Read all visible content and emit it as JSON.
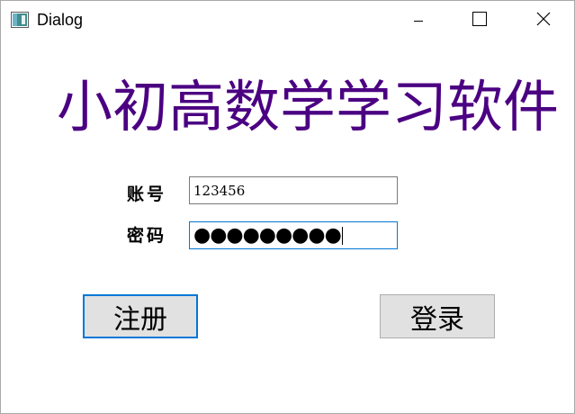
{
  "window": {
    "title": "Dialog",
    "icon": "app-window-icon",
    "controls": [
      "minimize-icon",
      "maximize-icon",
      "close-icon"
    ]
  },
  "heading": "小初高数学学习软件",
  "colors": {
    "heading": "#4b0082",
    "focus_border": "#0078d7",
    "button_bg": "#e1e1e1"
  },
  "form": {
    "account_label": "账号",
    "account_value": "123456",
    "password_label": "密码",
    "password_masked": "●●●●●●●●●"
  },
  "buttons": {
    "register": "注册",
    "login": "登录"
  }
}
